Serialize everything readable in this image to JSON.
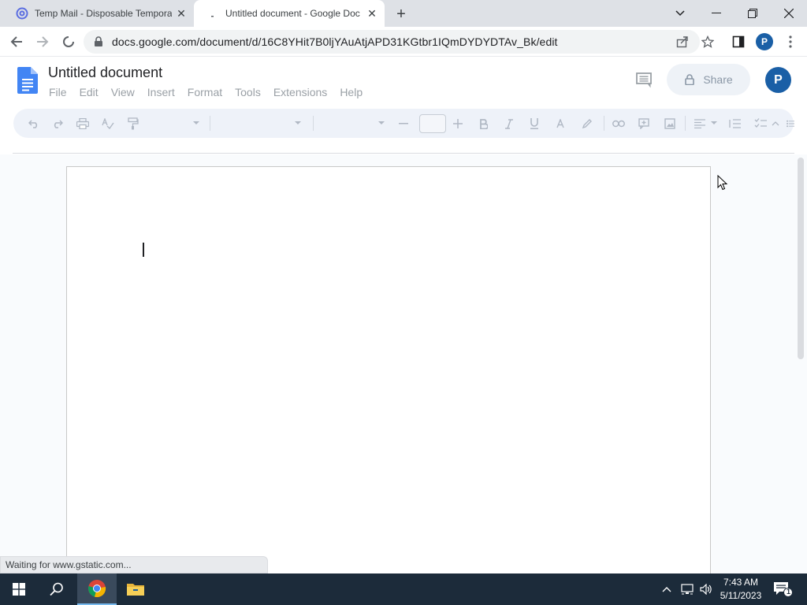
{
  "browser": {
    "tabs": [
      {
        "title": "Temp Mail - Disposable Tempora",
        "active": false
      },
      {
        "title": "Untitled document - Google Doc",
        "active": true
      }
    ],
    "new_tab": "+",
    "url": "docs.google.com/document/d/16C8YHit7B0ljYAuAtjAPD31KGtbr1IQmDYDYDTAv_Bk/edit",
    "profile_initial": "P"
  },
  "docs": {
    "title": "Untitled document",
    "menu": [
      "File",
      "Edit",
      "View",
      "Insert",
      "Format",
      "Tools",
      "Extensions",
      "Help"
    ],
    "share_label": "Share",
    "profile_initial": "P"
  },
  "status": {
    "loading_text": "Waiting for www.gstatic.com..."
  },
  "taskbar": {
    "time": "7:43 AM",
    "date": "5/11/2023",
    "notification_count": "1"
  },
  "colors": {
    "docs_blue": "#4285f4",
    "profile_blue": "#1a5fa6",
    "taskbar": "#1c2b3a"
  }
}
